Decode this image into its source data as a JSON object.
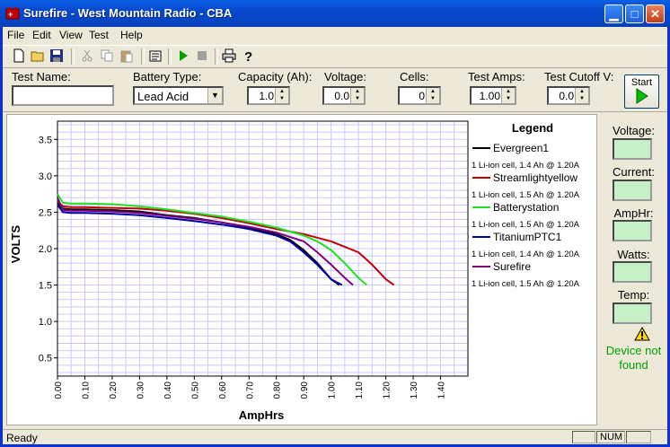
{
  "window": {
    "title": "Surefire - West Mountain Radio - CBA"
  },
  "menu": [
    "File",
    "Edit",
    "View",
    "Test",
    "Help"
  ],
  "toolbar": {
    "icons": [
      "new-file-icon",
      "open-folder-icon",
      "save-icon",
      "cut-icon",
      "copy-icon",
      "paste-icon",
      "properties-icon",
      "play-icon",
      "stop-icon",
      "print-icon",
      "help-icon"
    ]
  },
  "params": {
    "test_name_label": "Test Name:",
    "test_name_value": "",
    "battery_type_label": "Battery Type:",
    "battery_type_value": "Lead Acid",
    "capacity_label": "Capacity (Ah):",
    "capacity_value": "1.0",
    "voltage_label": "Voltage:",
    "voltage_value": "0.0",
    "cells_label": "Cells:",
    "cells_value": "0",
    "test_amps_label": "Test Amps:",
    "test_amps_value": "1.00",
    "cutoff_label": "Test Cutoff V:",
    "cutoff_value": "0.0",
    "start_label": "Start"
  },
  "side": {
    "voltage": "Voltage:",
    "current": "Current:",
    "amphr": "AmpHr:",
    "watts": "Watts:",
    "temp": "Temp:",
    "warning": "Device not found"
  },
  "status": {
    "text": "Ready",
    "num": "NUM"
  },
  "colors": {
    "grid": "#c8c8ff",
    "green": "#00a000"
  },
  "chart_data": {
    "type": "line",
    "xlabel": "AmpHrs",
    "ylabel": "VOLTS",
    "xlim": [
      0,
      1.5
    ],
    "ylim": [
      0.25,
      3.75
    ],
    "xticks": [
      "0.00",
      "0.10",
      "0.20",
      "0.30",
      "0.40",
      "0.50",
      "0.60",
      "0.70",
      "0.80",
      "0.90",
      "1.00",
      "1.10",
      "1.20",
      "1.30",
      "1.40"
    ],
    "yticks": [
      "0.5",
      "1.0",
      "1.5",
      "2.0",
      "2.5",
      "3.0",
      "3.5"
    ],
    "grid": true,
    "legend_title": "Legend",
    "series": [
      {
        "name": "Evergreen1",
        "desc": "1 Li-ion cell, 1.4 Ah @ 1.20A",
        "color": "#000000",
        "x": [
          0,
          0.02,
          0.05,
          0.1,
          0.2,
          0.3,
          0.4,
          0.5,
          0.6,
          0.7,
          0.8,
          0.85,
          0.9,
          0.95,
          1.0,
          1.03
        ],
        "y": [
          2.62,
          2.55,
          2.54,
          2.54,
          2.53,
          2.51,
          2.46,
          2.42,
          2.36,
          2.29,
          2.2,
          2.12,
          1.98,
          1.8,
          1.58,
          1.5
        ]
      },
      {
        "name": "Streamlightyellow",
        "desc": "1 Li-ion cell, 1.5 Ah @ 1.20A",
        "color": "#c00000",
        "x": [
          0,
          0.02,
          0.05,
          0.1,
          0.2,
          0.3,
          0.4,
          0.5,
          0.6,
          0.7,
          0.8,
          0.9,
          1.0,
          1.1,
          1.15,
          1.2,
          1.23
        ],
        "y": [
          2.65,
          2.58,
          2.57,
          2.57,
          2.56,
          2.55,
          2.52,
          2.48,
          2.42,
          2.35,
          2.27,
          2.2,
          2.1,
          1.95,
          1.78,
          1.58,
          1.5
        ]
      },
      {
        "name": "Batterystation",
        "desc": "1 Li-ion cell, 1.5 Ah @ 1.20A",
        "color": "#20e020",
        "x": [
          0,
          0.02,
          0.05,
          0.1,
          0.2,
          0.3,
          0.4,
          0.5,
          0.6,
          0.7,
          0.8,
          0.9,
          0.95,
          1.0,
          1.05,
          1.1,
          1.13
        ],
        "y": [
          2.75,
          2.63,
          2.62,
          2.62,
          2.61,
          2.58,
          2.54,
          2.49,
          2.44,
          2.37,
          2.29,
          2.18,
          2.1,
          1.98,
          1.8,
          1.6,
          1.5
        ]
      },
      {
        "name": "TitaniumPTC1",
        "desc": "1 Li-ion cell, 1.4 Ah @ 1.20A",
        "color": "#0000a0",
        "x": [
          0,
          0.02,
          0.05,
          0.1,
          0.2,
          0.3,
          0.4,
          0.5,
          0.6,
          0.7,
          0.8,
          0.85,
          0.9,
          0.95,
          1.0,
          1.04
        ],
        "y": [
          2.6,
          2.5,
          2.49,
          2.49,
          2.48,
          2.46,
          2.42,
          2.38,
          2.33,
          2.27,
          2.18,
          2.1,
          1.95,
          1.78,
          1.58,
          1.5
        ]
      },
      {
        "name": "Surefire",
        "desc": "1 Li-ion cell, 1.5 Ah @ 1.20A",
        "color": "#800080",
        "x": [
          0,
          0.02,
          0.05,
          0.1,
          0.2,
          0.3,
          0.4,
          0.5,
          0.6,
          0.7,
          0.8,
          0.9,
          0.95,
          1.0,
          1.05,
          1.08
        ],
        "y": [
          2.7,
          2.53,
          2.52,
          2.52,
          2.51,
          2.49,
          2.45,
          2.41,
          2.36,
          2.3,
          2.22,
          2.1,
          1.95,
          1.78,
          1.6,
          1.5
        ]
      }
    ]
  }
}
